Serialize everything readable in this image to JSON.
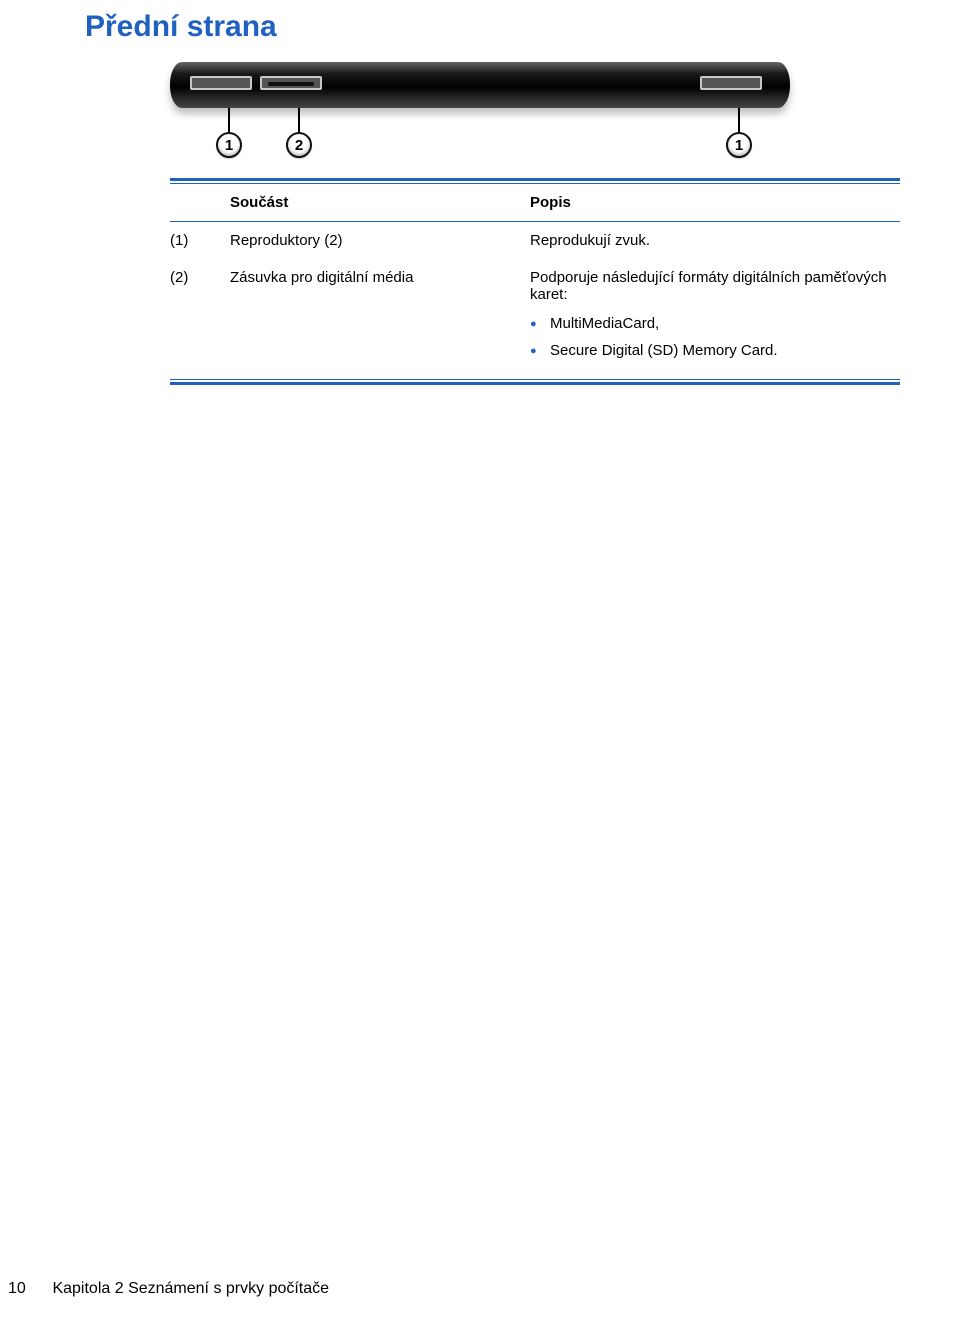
{
  "title": "Přední strana",
  "table": {
    "headers": {
      "component": "Součást",
      "description": "Popis"
    },
    "rows": [
      {
        "num": "(1)",
        "name": "Reproduktory (2)",
        "desc": "Reprodukují zvuk."
      },
      {
        "num": "(2)",
        "name": "Zásuvka pro digitální média",
        "desc": "Podporuje následující formáty digitálních paměťových karet:",
        "bullets": [
          "MultiMediaCard,",
          "Secure Digital (SD) Memory Card."
        ]
      }
    ]
  },
  "callouts": [
    "1",
    "2",
    "1"
  ],
  "footer": {
    "page": "10",
    "chapter": "Kapitola 2   Seznámení s prvky počítače"
  }
}
